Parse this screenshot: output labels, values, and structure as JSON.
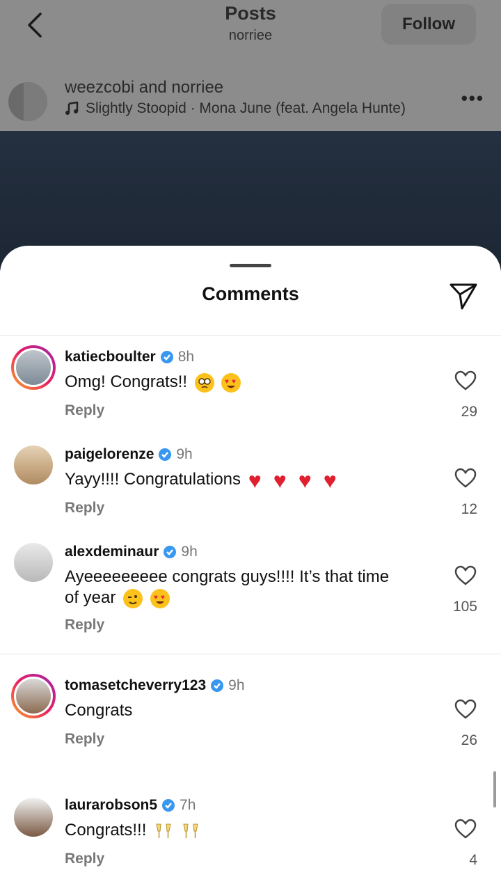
{
  "header": {
    "title": "Posts",
    "subtitle": "norriee",
    "follow_label": "Follow"
  },
  "post": {
    "users": "weezcobi and norriee",
    "music": "Slightly Stoopid · Mona June (feat. Angela Hunte)"
  },
  "sheet": {
    "title": "Comments"
  },
  "comments": [
    {
      "username": "katiecboulter",
      "time": "8h",
      "text": "Omg! Congrats!!",
      "emojis": [
        "pleading-face",
        "heart-eyes"
      ],
      "reply": "Reply",
      "likes": "29"
    },
    {
      "username": "paigelorenze",
      "time": "9h",
      "text": "Yayy!!!! Congratulations",
      "emojis": [
        "red-heart",
        "red-heart",
        "red-heart",
        "red-heart"
      ],
      "reply": "Reply",
      "likes": "12"
    },
    {
      "username": "alexdeminaur",
      "time": "9h",
      "text_line1": "Ayeeeeeeeee congrats guys!!!! It’s that time",
      "text_line2": "of year",
      "emojis": [
        "winking-face",
        "heart-eyes"
      ],
      "reply": "Reply",
      "likes": "105"
    },
    {
      "username": "tomasetcheverry123",
      "time": "9h",
      "text": "Congrats",
      "reply": "Reply",
      "likes": "26"
    },
    {
      "username": "laurarobson5",
      "time": "7h",
      "text": "Congrats!!!",
      "emojis": [
        "clinking-glasses",
        "clinking-glasses"
      ],
      "reply": "Reply",
      "likes": "4"
    }
  ],
  "colors": {
    "verified": "#3897f0",
    "ring_start": "#f9a825",
    "ring_end": "#9c27b0"
  }
}
